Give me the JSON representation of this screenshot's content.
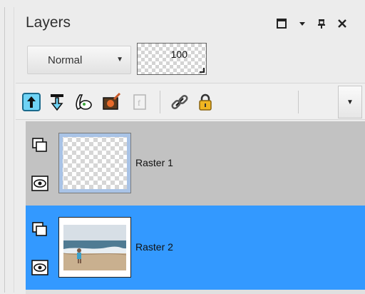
{
  "panel": {
    "title": "Layers",
    "window_buttons": [
      "maximize-icon",
      "dropdown-icon",
      "pin-icon",
      "close-icon"
    ]
  },
  "blend_mode": {
    "selected": "Normal"
  },
  "opacity": {
    "value": "100"
  },
  "toolbar": {
    "tools": [
      "move-layer-up-icon",
      "move-layer-down-icon",
      "new-raster-layer-icon",
      "new-mask-layer-icon",
      "new-adjustment-layer-icon",
      "link-icon",
      "lock-icon"
    ],
    "overflow": "chevron-down-icon"
  },
  "layers": [
    {
      "name": "Raster 1",
      "selected": false,
      "thumbnail": "transparent"
    },
    {
      "name": "Raster 2",
      "selected": true,
      "thumbnail": "beach-photo"
    }
  ],
  "colors": {
    "selected_row": "#3399ff",
    "unselected_row": "#c2c2c2",
    "panel_bg": "#ececec"
  }
}
